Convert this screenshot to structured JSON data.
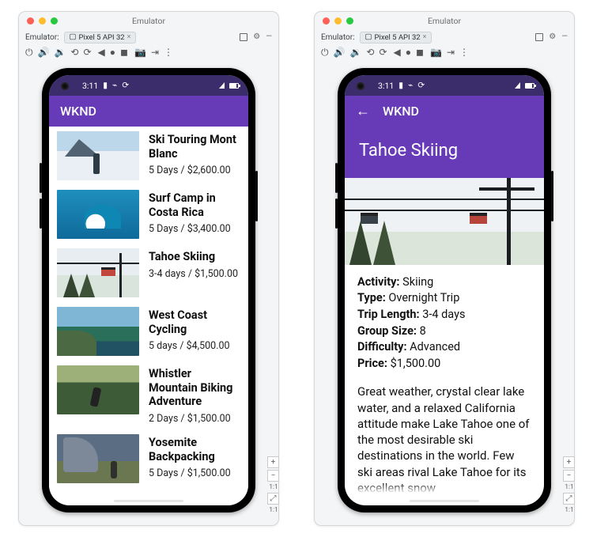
{
  "emulator": {
    "window_title": "Emulator",
    "label_prefix": "Emulator:",
    "device_tab": "Pixel 5 API 32",
    "zoom_label": "1:1"
  },
  "status_bar": {
    "time": "3:11"
  },
  "app": {
    "name": "WKND"
  },
  "list": [
    {
      "title": "Ski Touring Mont Blanc",
      "subtitle": "5 Days / $2,600.00"
    },
    {
      "title": "Surf Camp in Costa Rica",
      "subtitle": "5 Days / $3,400.00"
    },
    {
      "title": "Tahoe Skiing",
      "subtitle": "3-4 days / $1,500.00"
    },
    {
      "title": "West Coast Cycling",
      "subtitle": "5 days / $4,500.00"
    },
    {
      "title": "Whistler Mountain Biking Adventure",
      "subtitle": "2 Days / $1,500.00"
    },
    {
      "title": "Yosemite Backpacking",
      "subtitle": "5 Days / $1,500.00"
    }
  ],
  "detail": {
    "title": "Tahoe Skiing",
    "fields": {
      "activity": {
        "label": "Activity:",
        "value": "Skiing"
      },
      "type": {
        "label": "Type:",
        "value": "Overnight Trip"
      },
      "tripLength": {
        "label": "Trip Length:",
        "value": "3-4 days"
      },
      "groupSize": {
        "label": "Group Size:",
        "value": "8"
      },
      "difficulty": {
        "label": "Difficulty:",
        "value": "Advanced"
      },
      "price": {
        "label": "Price:",
        "value": "$1,500.00"
      }
    },
    "description": "Great weather, crystal clear lake water, and a relaxed California attitude make Lake Tahoe one of the most desirable ski destinations in the world. Few ski areas rival Lake Tahoe for its excellent snow"
  }
}
